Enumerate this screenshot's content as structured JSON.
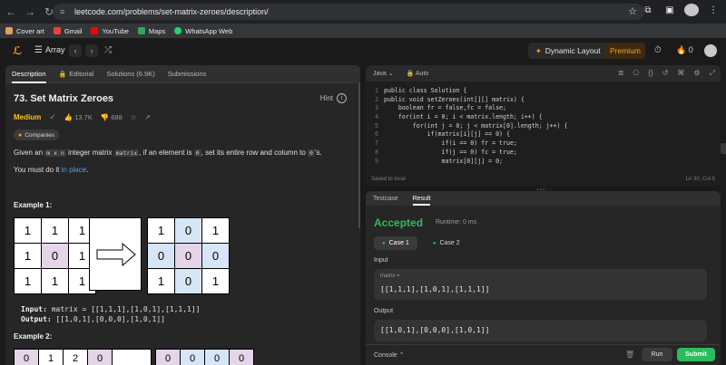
{
  "browser": {
    "url": "leetcode.com/problems/set-matrix-zeroes/description/",
    "bookmarks": [
      {
        "label": "Cover art",
        "color": "#e0a060"
      },
      {
        "label": "Gmail",
        "color": "#ea4335"
      },
      {
        "label": "YouTube",
        "color": "#ff0000"
      },
      {
        "label": "Maps",
        "color": "#34a853"
      },
      {
        "label": "WhatsApp Web",
        "color": "#25d366"
      }
    ]
  },
  "header": {
    "title": "Array",
    "dynamic_layout": "Dynamic Layout",
    "premium": "Premium",
    "streak": "0"
  },
  "left": {
    "tabs": [
      "Description",
      "Editorial",
      "Solutions (6.9K)",
      "Submissions"
    ],
    "title": "73. Set Matrix Zeroes",
    "hint": "Hint",
    "difficulty": "Medium",
    "likes": "13.7K",
    "dislikes": "688",
    "companies": "Companies",
    "desc_parts": {
      "p1": "Given an ",
      "m_x_n": "m x n",
      "p2": " integer matrix ",
      "matrix": "matrix",
      "p3": ", if an element is ",
      "zero": "0",
      "p4": ", set its entire row and column to ",
      "zeros": "0",
      "p5": "'s."
    },
    "desc2_pre": "You must do it ",
    "desc2_link": "in place",
    "desc2_post": ".",
    "example1": "Example 1:",
    "example2": "Example 2:",
    "input_label": "Input:",
    "input_value": "matrix = [[1,1,1],[1,0,1],[1,1,1]]",
    "output_label": "Output:",
    "output_value": "[[1,0,1],[0,0,0],[1,0,1]]",
    "matrix_in": [
      "1",
      "1",
      "1",
      "1",
      "0",
      "1",
      "1",
      "1",
      "1"
    ],
    "matrix_out": [
      "1",
      "0",
      "1",
      "0",
      "0",
      "0",
      "1",
      "0",
      "1"
    ],
    "matrix2_in": [
      "0",
      "1",
      "2",
      "0"
    ],
    "matrix2_out": [
      "0",
      "0",
      "0",
      "0"
    ]
  },
  "code": {
    "language": "Java",
    "mode": "Auto",
    "lines": [
      "public class Solution {",
      "public void setZeroes(int[][] matrix) {",
      "    boolean fr = false,fc = false;",
      "    for(int i = 0; i < matrix.length; i++) {",
      "        for(int j = 0; j < matrix[0].length; j++) {",
      "            if(matrix[i][j] == 0) {",
      "                if(i == 0) fr = true;",
      "                if(j == 0) fc = true;",
      "                matrix[0][j] = 0;"
    ],
    "saved": "Saved to local",
    "cursor": "Ln 30, Col 5"
  },
  "result": {
    "tabs": [
      "Testcase",
      "Result"
    ],
    "status": "Accepted",
    "runtime": "Runtime: 0 ms",
    "cases": [
      "Case 1",
      "Case 2"
    ],
    "input_label": "Input",
    "var_name": "matrix =",
    "input_value": "[[1,1,1],[1,0,1],[1,1,1]]",
    "output_label": "Output",
    "output_value": "[[1,0,1],[0,0,0],[1,0,1]]",
    "console": "Console",
    "run": "Run",
    "submit": "Submit"
  }
}
